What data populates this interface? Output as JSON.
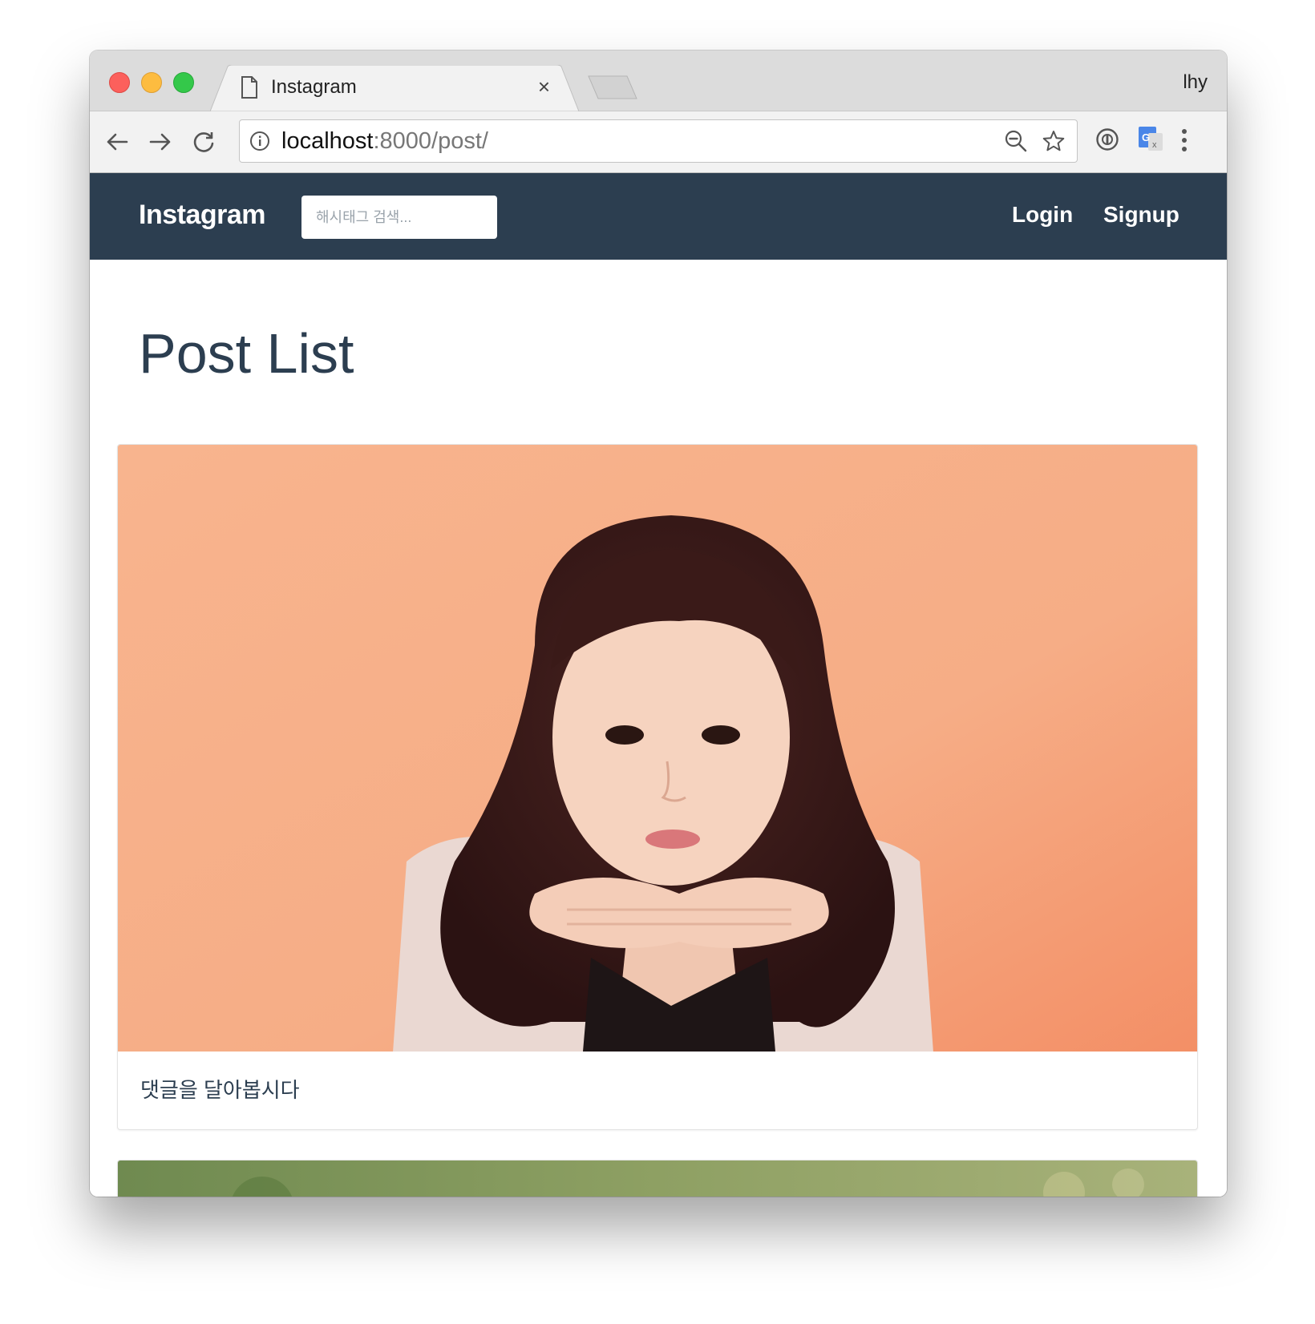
{
  "browser": {
    "tab": {
      "title": "Instagram",
      "close_label": "×"
    },
    "profile_name": "lhy",
    "url": {
      "host": "localhost",
      "path": ":8000/post/"
    }
  },
  "navbar": {
    "brand": "Instagram",
    "search_placeholder": "해시태그 검색...",
    "links": {
      "login": "Login",
      "signup": "Signup"
    },
    "color": "#2c3e50"
  },
  "main": {
    "title": "Post List",
    "posts": [
      {
        "caption": "댓글을 달아봅시다",
        "image": "portrait-photo"
      },
      {
        "caption": "",
        "image": "nature-photo"
      }
    ]
  }
}
